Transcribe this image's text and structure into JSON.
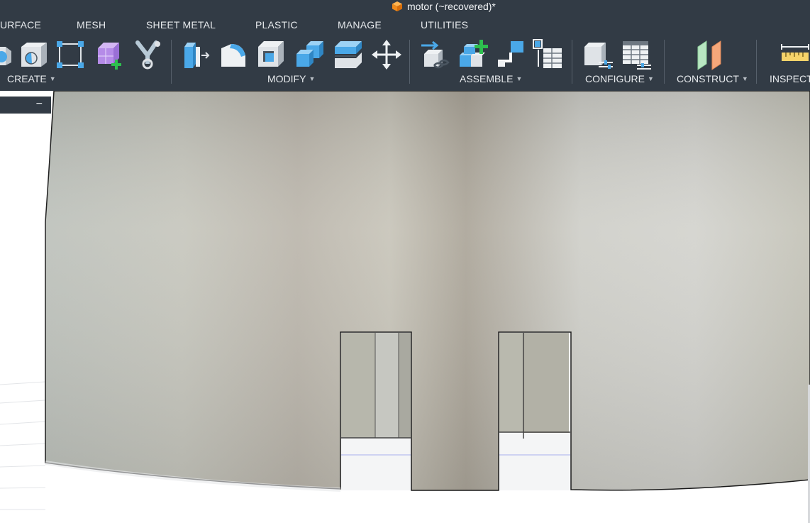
{
  "window": {
    "title": "motor (~recovered)*",
    "title_icon": "orange-cube-icon"
  },
  "tabs": [
    "URFACE",
    "MESH",
    "SHEET METAL",
    "PLASTIC",
    "MANAGE",
    "UTILITIES"
  ],
  "toolbar": {
    "groups": {
      "create": "CREATE",
      "modify": "MODIFY",
      "assemble": "ASSEMBLE",
      "configure": "CONFIGURE",
      "construct": "CONSTRUCT",
      "inspect": "INSPECT"
    },
    "tools": {
      "create": [
        "revolve-icon",
        "hole-icon",
        "sketch-rectangle-icon",
        "form-box-icon",
        "pipe-icon"
      ],
      "modify": [
        "press-pull-icon",
        "fillet-icon",
        "shell-icon",
        "combine-icon",
        "offset-face-icon",
        "move-icon"
      ],
      "assemble": [
        "joint-icon",
        "new-component-icon",
        "as-built-joint-icon",
        "joint-table-icon"
      ],
      "configure": [
        "configure-component-icon",
        "configuration-table-icon"
      ],
      "construct": [
        "offset-plane-icon"
      ],
      "inspect": [
        "measure-icon"
      ]
    }
  },
  "browser": {
    "collapse_label": "−"
  },
  "colors": {
    "toolbar_bg": "#323b45",
    "accent_blue": "#4aa8e8",
    "add_green": "#2dbf4e",
    "model_surface": "#cfd0c8",
    "sketch_purple": "#b58be8"
  }
}
